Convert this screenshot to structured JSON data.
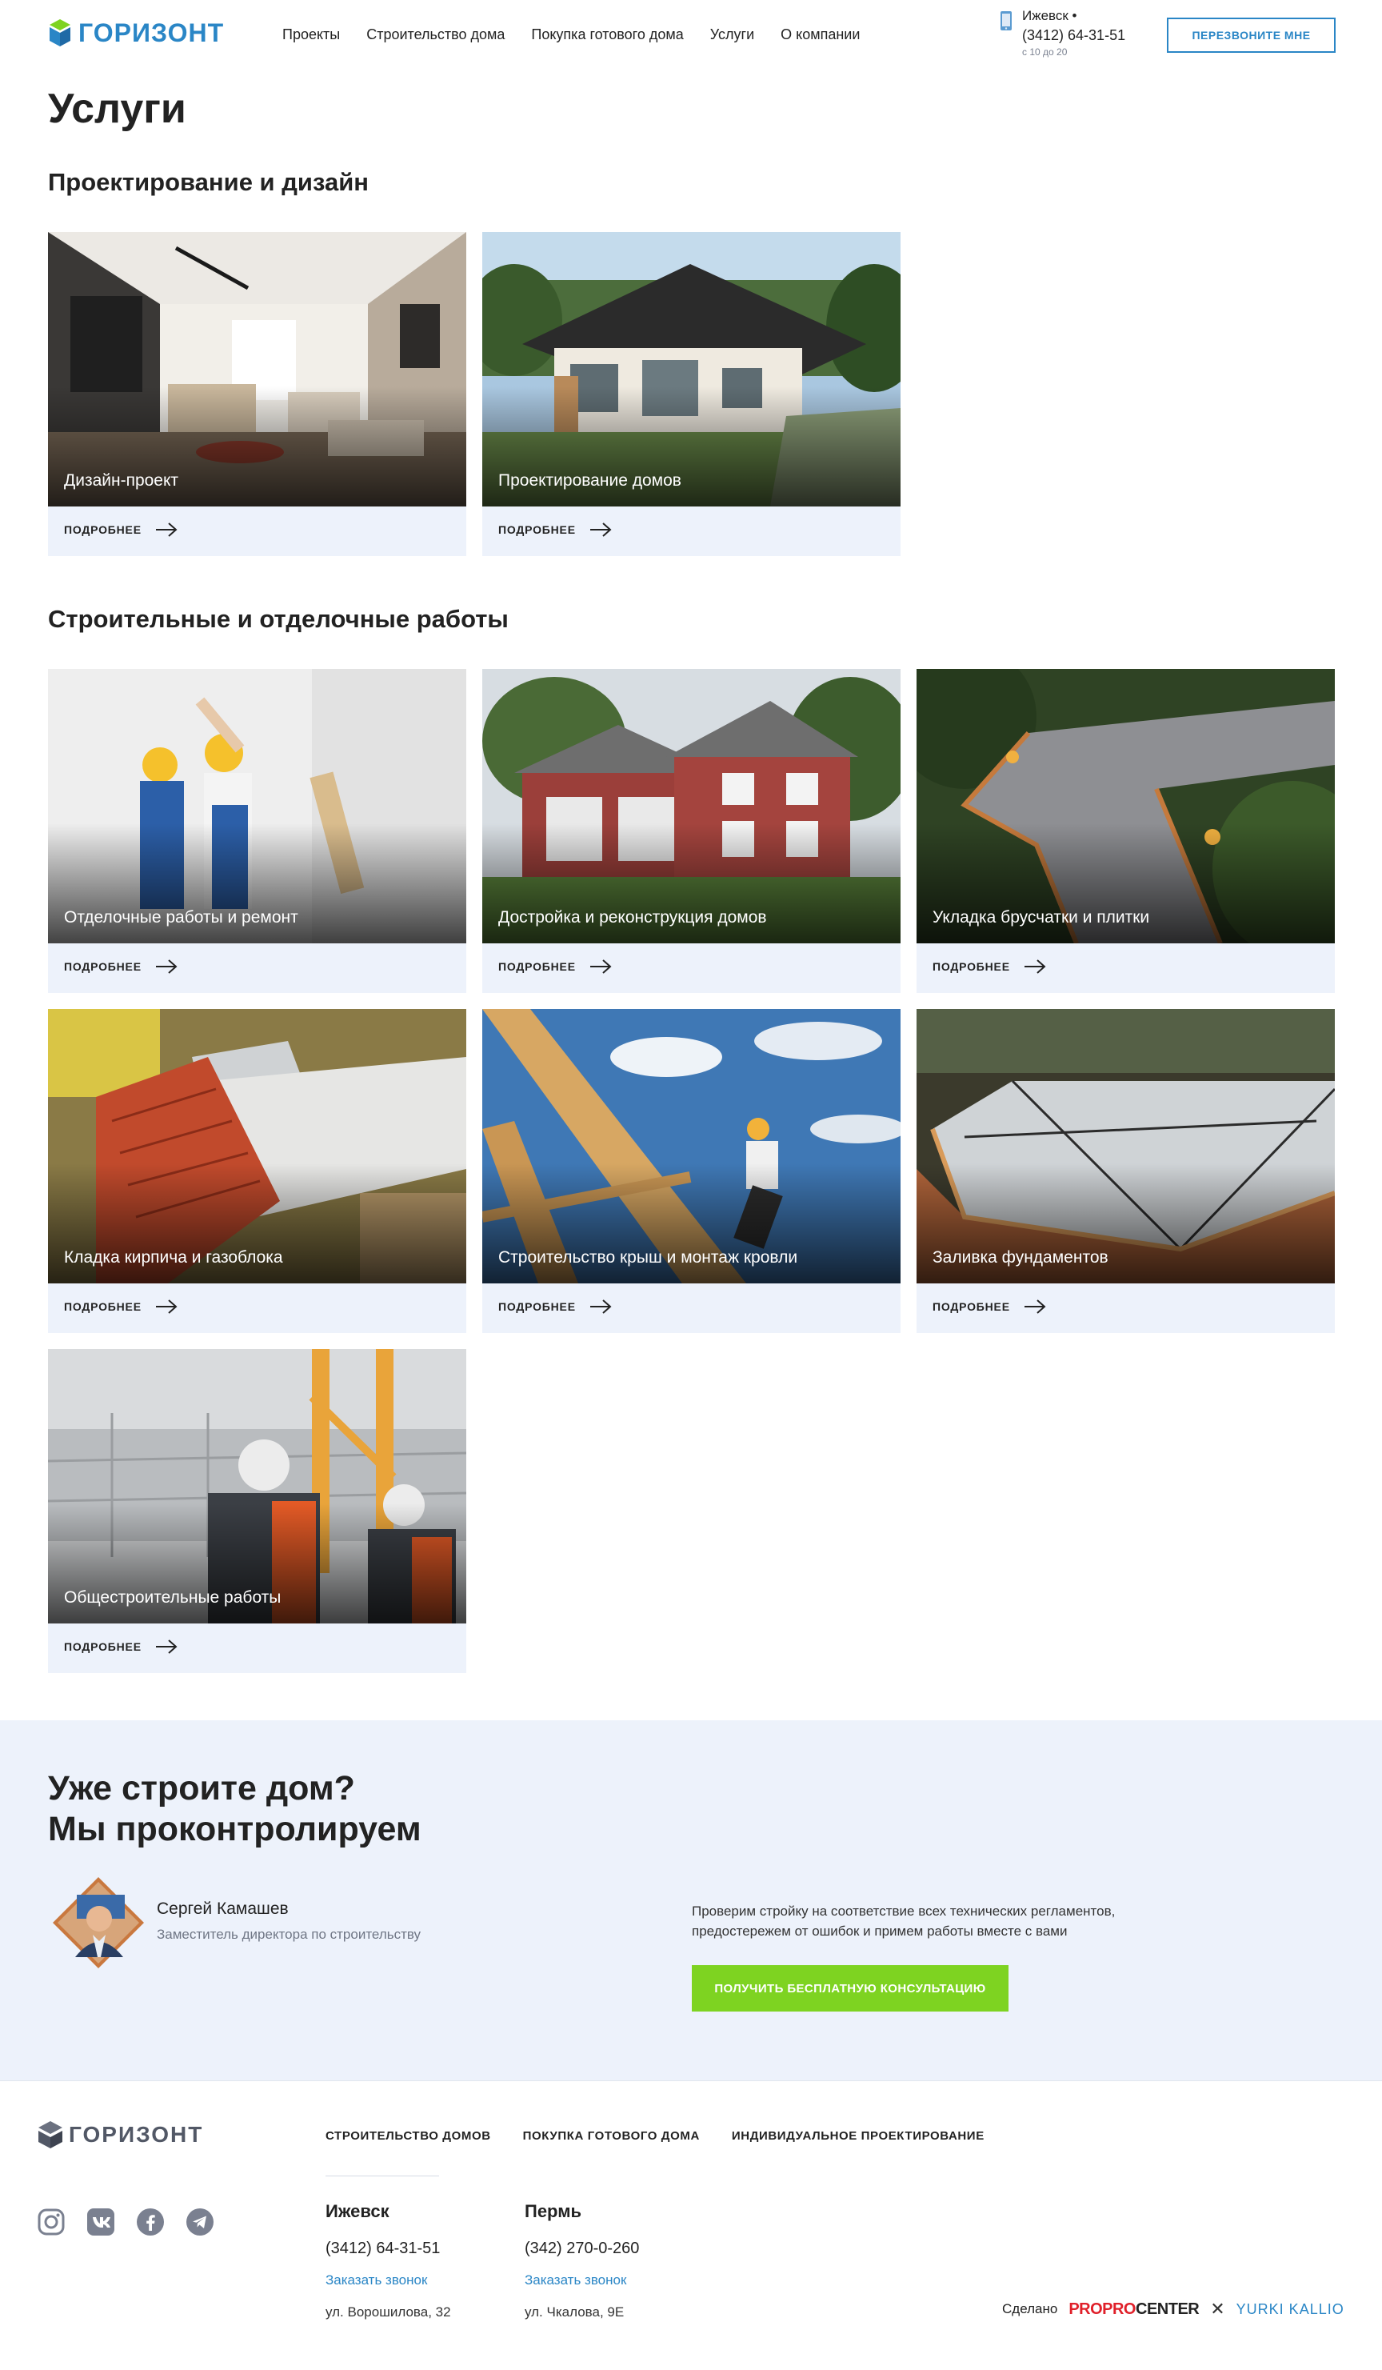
{
  "header": {
    "logo_text": "ГОРИЗОНТ",
    "nav": [
      "Проекты",
      "Строительство дома",
      "Покупка готового дома",
      "Услуги",
      "О компании"
    ],
    "city": "Ижевск •",
    "phone": "(3412) 64-31-51",
    "hours": "с 10 до 20",
    "callback_label": "ПЕРЕЗВОНИТЕ МНЕ"
  },
  "page_title": "Услуги",
  "sections": [
    {
      "title": "Проектирование и дизайн",
      "cards": [
        {
          "title": "Дизайн-проект",
          "more": "ПОДРОБНЕЕ"
        },
        {
          "title": "Проектирование домов",
          "more": "ПОДРОБНЕЕ"
        }
      ]
    },
    {
      "title": "Строительные и отделочные работы",
      "cards": [
        {
          "title": "Отделочные работы и ремонт",
          "more": "ПОДРОБНЕЕ"
        },
        {
          "title": "Достройка и реконструкция домов",
          "more": "ПОДРОБНЕЕ"
        },
        {
          "title": "Укладка брусчатки и плитки",
          "more": "ПОДРОБНЕЕ"
        },
        {
          "title": "Кладка кирпича и газоблока",
          "more": "ПОДРОБНЕЕ"
        },
        {
          "title": "Строительство крыш и монтаж кровли",
          "more": "ПОДРОБНЕЕ"
        },
        {
          "title": "Заливка фундаментов",
          "more": "ПОДРОБНЕЕ"
        },
        {
          "title": "Общестроительные работы",
          "more": "ПОДРОБНЕЕ"
        }
      ]
    }
  ],
  "promo": {
    "title_line1": "Уже строите дом?",
    "title_line2": "Мы проконтролируем",
    "person_name": "Сергей Камашев",
    "person_role": "Заместитель директора по строительству",
    "text_line1": "Проверим стройку на соответствие всех технических регламентов,",
    "text_line2": "предостережем от ошибок и примем работы вместе с вами",
    "button": "ПОЛУЧИТЬ БЕСПЛАТНУЮ КОНСУЛЬТАЦИЮ"
  },
  "footer": {
    "logo_text": "ГОРИЗОНТ",
    "nav": [
      "СТРОИТЕЛЬСТВО ДОМОВ",
      "ПОКУПКА ГОТОВОГО ДОМА",
      "ИНДИВИДУАЛЬНОЕ ПРОЕКТИРОВАНИЕ"
    ],
    "socials": [
      "instagram-icon",
      "vk-icon",
      "facebook-icon",
      "telegram-icon"
    ],
    "offices": [
      {
        "city": "Ижевск",
        "phone": "(3412) 64-31-51",
        "order": "Заказать звонок",
        "address": "ул. Ворошилова, 32"
      },
      {
        "city": "Пермь",
        "phone": "(342) 270-0-260",
        "order": "Заказать звонок",
        "address": "ул. Чкалова, 9Е"
      }
    ],
    "made_by": "Сделано",
    "studio1_a": "PROPRO",
    "studio1_b": "CENTER",
    "studio2": "YURKI KALLIO"
  },
  "colors": {
    "accent_blue": "#2a86c6",
    "accent_green": "#7ed321",
    "card_bg": "#edf2fb",
    "text": "#222222"
  }
}
